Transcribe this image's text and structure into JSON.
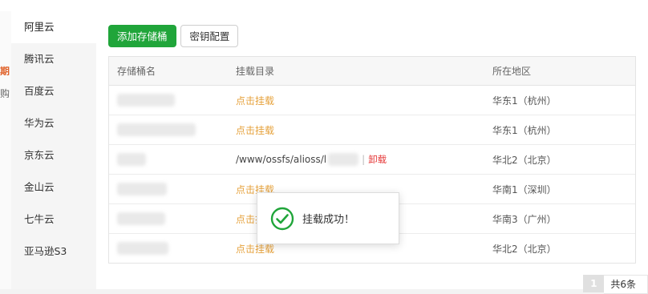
{
  "sidebar": {
    "items": [
      {
        "label": "阿里云",
        "active": true
      },
      {
        "label": "腾讯云"
      },
      {
        "label": "百度云"
      },
      {
        "label": "华为云"
      },
      {
        "label": "京东云"
      },
      {
        "label": "金山云"
      },
      {
        "label": "七牛云"
      },
      {
        "label": "亚马逊S3"
      }
    ]
  },
  "left_edge": {
    "frag1": "期",
    "frag2": "购"
  },
  "toolbar": {
    "add_label": "添加存储桶",
    "key_label": "密钥配置"
  },
  "table": {
    "headers": [
      "存储桶名",
      "挂载目录",
      "所在地区"
    ],
    "rows": [
      {
        "mount": "点击挂载",
        "region": "华东1（杭州）"
      },
      {
        "mount": "点击挂载",
        "region": "华东1（杭州）"
      },
      {
        "path": "/www/ossfs/alioss/l",
        "separator": "|",
        "unmount": "卸载",
        "region": "华北2（北京）"
      },
      {
        "mount": "点击挂载",
        "region": "华南1（深圳）"
      },
      {
        "mount": "点击挂载",
        "region": "华南3（广州）"
      },
      {
        "mount": "点击挂载",
        "region": "华北2（北京）"
      }
    ]
  },
  "pagination": {
    "current": "1",
    "total": "共6条"
  },
  "toast": {
    "message": "挂载成功！",
    "icon": "check-circle-icon",
    "color": "#20a53a"
  }
}
